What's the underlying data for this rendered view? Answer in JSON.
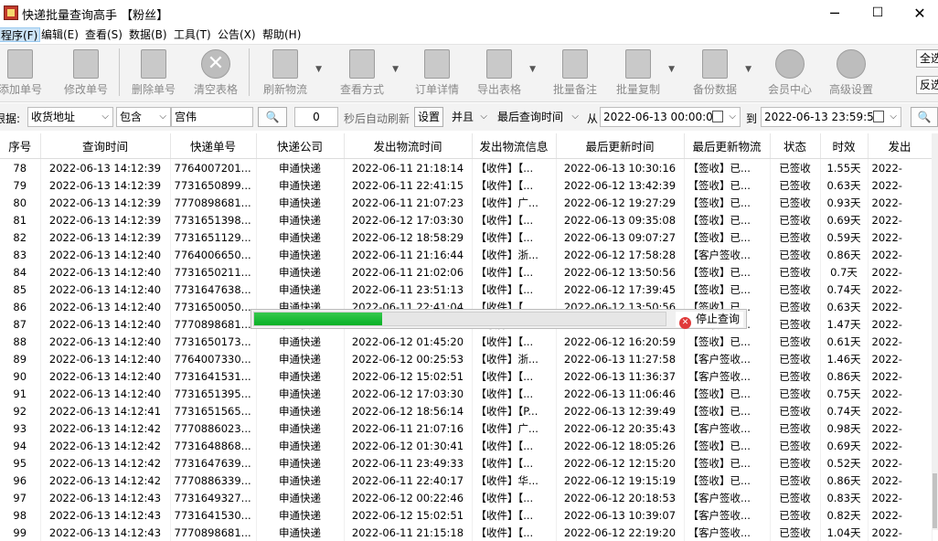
{
  "window": {
    "title": "快递批量查询高手 【粉丝】",
    "minimize": "─",
    "maximize": "☐",
    "close": "✕"
  },
  "menu": [
    {
      "label": "程序(F)",
      "active": true
    },
    {
      "label": "编辑(E)"
    },
    {
      "label": "查看(S)"
    },
    {
      "label": "数据(B)"
    },
    {
      "label": "工具(T)"
    },
    {
      "label": "公告(X)"
    },
    {
      "label": "帮助(H)"
    }
  ],
  "toolbar": {
    "buttons": [
      {
        "label": "添加单号",
        "icon": "add-doc-icon"
      },
      {
        "label": "修改单号",
        "icon": "edit-doc-icon"
      },
      {
        "label": "删除单号",
        "icon": "delete-doc-icon"
      },
      {
        "label": "清空表格",
        "icon": "clear-icon"
      },
      {
        "label": "刷新物流",
        "icon": "refresh-icon"
      },
      {
        "label": "查看方式",
        "icon": "view-icon"
      },
      {
        "label": "订单详情",
        "icon": "detail-icon"
      },
      {
        "label": "导出表格",
        "icon": "export-icon"
      },
      {
        "label": "批量备注",
        "icon": "note-icon"
      },
      {
        "label": "批量复制",
        "icon": "copy-icon"
      },
      {
        "label": "备份数据",
        "icon": "backup-icon"
      },
      {
        "label": "会员中心",
        "icon": "clock-icon"
      },
      {
        "label": "高级设置",
        "icon": "settings-icon"
      }
    ],
    "side_buttons": {
      "select_all": "全选",
      "invert": "反选"
    }
  },
  "filter": {
    "field_label_partial": "根据:",
    "field": "收货地址",
    "operator": "包含",
    "value": "宫伟",
    "refresh_seconds": "0",
    "refresh_label": "秒后自动刷新",
    "settings_button": "设置",
    "logic": "并且",
    "time_field": "最后查询时间",
    "from_label": "从",
    "from": "2022-06-13 00:00:00",
    "to_label": "到",
    "to": "2022-06-13 23:59:59"
  },
  "table": {
    "columns": [
      "序号",
      "查询时间",
      "快递单号",
      "快递公司",
      "发出物流时间",
      "发出物流信息",
      "最后更新时间",
      "最后更新物流",
      "状态",
      "时效",
      "发出"
    ],
    "rows": [
      [
        "78",
        "2022-06-13 14:12:39",
        "7764007201...",
        "申通快递",
        "2022-06-11 21:18:14",
        "【收件】【...",
        "2022-06-13 10:30:16",
        "【签收】已...",
        "已签收",
        "1.55天",
        "2022-"
      ],
      [
        "79",
        "2022-06-13 14:12:39",
        "7731650899...",
        "申通快递",
        "2022-06-11 22:41:15",
        "【收件】【...",
        "2022-06-12 13:42:39",
        "【签收】已...",
        "已签收",
        "0.63天",
        "2022-"
      ],
      [
        "80",
        "2022-06-13 14:12:39",
        "7770898681...",
        "申通快递",
        "2022-06-11 21:07:23",
        "【收件】广...",
        "2022-06-12 19:27:29",
        "【签收】已...",
        "已签收",
        "0.93天",
        "2022-"
      ],
      [
        "81",
        "2022-06-13 14:12:39",
        "7731651398...",
        "申通快递",
        "2022-06-12 17:03:30",
        "【收件】【...",
        "2022-06-13 09:35:08",
        "【签收】已...",
        "已签收",
        "0.69天",
        "2022-"
      ],
      [
        "82",
        "2022-06-13 14:12:39",
        "7731651129...",
        "申通快递",
        "2022-06-12 18:58:29",
        "【收件】【...",
        "2022-06-13 09:07:27",
        "【签收】已...",
        "已签收",
        "0.59天",
        "2022-"
      ],
      [
        "83",
        "2022-06-13 14:12:40",
        "7764006650...",
        "申通快递",
        "2022-06-11 21:16:44",
        "【收件】浙...",
        "2022-06-12 17:58:28",
        "【客户签收...",
        "已签收",
        "0.86天",
        "2022-"
      ],
      [
        "84",
        "2022-06-13 14:12:40",
        "7731650211...",
        "申通快递",
        "2022-06-11 21:02:06",
        "【收件】【...",
        "2022-06-12 13:50:56",
        "【签收】已...",
        "已签收",
        "0.7天",
        "2022-"
      ],
      [
        "85",
        "2022-06-13 14:12:40",
        "7731647638...",
        "申通快递",
        "2022-06-11 23:51:13",
        "【收件】【...",
        "2022-06-12 17:39:45",
        "【签收】已...",
        "已签收",
        "0.74天",
        "2022-"
      ],
      [
        "86",
        "2022-06-13 14:12:40",
        "7731650050...",
        "申通快递",
        "2022-06-11 22:41:04",
        "【收件】【...",
        "2022-06-12 13:50:56",
        "【签收】已...",
        "已签收",
        "0.63天",
        "2022-"
      ],
      [
        "87",
        "2022-06-13 14:12:40",
        "7770898681...",
        "申通快递",
        "2022-06-12 03:01:00",
        "【收件】【...",
        "2022-06-13 12:13:08",
        "【签收】已...",
        "已签收",
        "1.47天",
        "2022-"
      ],
      [
        "88",
        "2022-06-13 14:12:40",
        "7731650173...",
        "申通快递",
        "2022-06-12 01:45:20",
        "【收件】【...",
        "2022-06-12 16:20:59",
        "【签收】已...",
        "已签收",
        "0.61天",
        "2022-"
      ],
      [
        "89",
        "2022-06-13 14:12:40",
        "7764007330...",
        "申通快递",
        "2022-06-12 00:25:53",
        "【收件】浙...",
        "2022-06-13 11:27:58",
        "【客户签收...",
        "已签收",
        "1.46天",
        "2022-"
      ],
      [
        "90",
        "2022-06-13 14:12:40",
        "7731641531...",
        "申通快递",
        "2022-06-12 15:02:51",
        "【收件】【...",
        "2022-06-13 11:36:37",
        "【客户签收...",
        "已签收",
        "0.86天",
        "2022-"
      ],
      [
        "91",
        "2022-06-13 14:12:40",
        "7731651395...",
        "申通快递",
        "2022-06-12 17:03:30",
        "【收件】【...",
        "2022-06-13 11:06:46",
        "【签收】已...",
        "已签收",
        "0.75天",
        "2022-"
      ],
      [
        "92",
        "2022-06-13 14:12:41",
        "7731651565...",
        "申通快递",
        "2022-06-12 18:56:14",
        "【收件】【P...",
        "2022-06-13 12:39:49",
        "【签收】已...",
        "已签收",
        "0.74天",
        "2022-"
      ],
      [
        "93",
        "2022-06-13 14:12:42",
        "7770886023...",
        "申通快递",
        "2022-06-11 21:07:16",
        "【收件】广...",
        "2022-06-12 20:35:43",
        "【客户签收...",
        "已签收",
        "0.98天",
        "2022-"
      ],
      [
        "94",
        "2022-06-13 14:12:42",
        "7731648868...",
        "申通快递",
        "2022-06-12 01:30:41",
        "【收件】【...",
        "2022-06-12 18:05:26",
        "【签收】已...",
        "已签收",
        "0.69天",
        "2022-"
      ],
      [
        "95",
        "2022-06-13 14:12:42",
        "7731647639...",
        "申通快递",
        "2022-06-11 23:49:33",
        "【收件】【...",
        "2022-06-12 12:15:20",
        "【签收】已...",
        "已签收",
        "0.52天",
        "2022-"
      ],
      [
        "96",
        "2022-06-13 14:12:42",
        "7770886339...",
        "申通快递",
        "2022-06-11 22:40:17",
        "【收件】华...",
        "2022-06-12 19:15:19",
        "【签收】已...",
        "已签收",
        "0.86天",
        "2022-"
      ],
      [
        "97",
        "2022-06-13 14:12:43",
        "7731649327...",
        "申通快递",
        "2022-06-12 00:22:46",
        "【收件】【...",
        "2022-06-12 20:18:53",
        "【客户签收...",
        "已签收",
        "0.83天",
        "2022-"
      ],
      [
        "98",
        "2022-06-13 14:12:43",
        "7731641530...",
        "申通快递",
        "2022-06-12 15:02:51",
        "【收件】【...",
        "2022-06-13 10:39:07",
        "【客户签收...",
        "已签收",
        "0.82天",
        "2022-"
      ],
      [
        "99",
        "2022-06-13 14:12:43",
        "7770898681...",
        "申通快递",
        "2022-06-11 21:15:18",
        "【收件】【...",
        "2022-06-12 22:19:20",
        "【客户签收...",
        "已签收",
        "1.04天",
        "2022-"
      ]
    ]
  },
  "progress": {
    "fraction": 0.31,
    "stop_label": "停止查询",
    "stop_icon": "stop-icon"
  },
  "colors": {
    "progress_green": "#06b025",
    "stop_red": "#e03a3a"
  }
}
